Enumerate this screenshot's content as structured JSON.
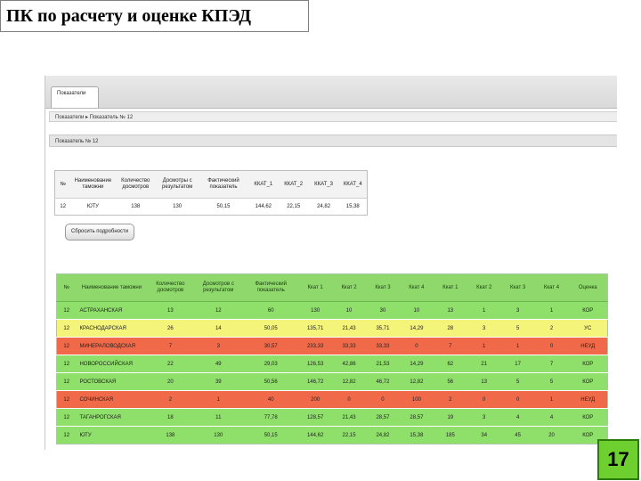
{
  "slide": {
    "title": "ПК по расчету и оценке КПЭД",
    "page_number": "17"
  },
  "app": {
    "tab_label": "Показатели",
    "breadcrumb": "Показатели ▸ Показатель № 12",
    "panel_title": "Показатель № 12",
    "reset_button_label": "Сбросить подробности"
  },
  "summary_table": {
    "headers": [
      "№",
      "Наименование таможни",
      "Количество досмотров",
      "Досмотры с результатом",
      "Фактический показатель",
      "ККАТ_1",
      "ККАТ_2",
      "ККАТ_3",
      "ККАТ_4"
    ],
    "rows": [
      [
        "12",
        "ЮТУ",
        "138",
        "130",
        "50,15",
        "144,62",
        "22,15",
        "24,82",
        "15,38"
      ]
    ]
  },
  "detail_table": {
    "headers": [
      "№",
      "Наименование таможни",
      "Количество досмотров",
      "Досмотров с результатом",
      "Фактический показатель",
      "Ккат 1",
      "Ккат 2",
      "Ккат 3",
      "Ккат 4",
      "Ккат 1",
      "Ккат 2",
      "Ккат 3",
      "Ккат 4",
      "Оценка"
    ],
    "row_colors": {
      "green": "#8ee06a",
      "yellow": "#f4f37a",
      "red": "#f06a4a"
    },
    "rows": [
      {
        "color": "green",
        "cells": [
          "12",
          "АСТРАХАНСКАЯ",
          "13",
          "12",
          "60",
          "130",
          "10",
          "30",
          "10",
          "13",
          "1",
          "3",
          "1",
          "КОР"
        ]
      },
      {
        "color": "yellow",
        "cells": [
          "12",
          "КРАСНОДАРСКАЯ",
          "26",
          "14",
          "50,05",
          "135,71",
          "21,43",
          "35,71",
          "14,29",
          "28",
          "3",
          "5",
          "2",
          "УС"
        ]
      },
      {
        "color": "red",
        "cells": [
          "12",
          "МИНЕРАЛОВОДСКАЯ",
          "7",
          "3",
          "30,57",
          "233,33",
          "33,33",
          "33,33",
          "0",
          "7",
          "1",
          "1",
          "0",
          "НЕУД"
        ]
      },
      {
        "color": "green",
        "cells": [
          "12",
          "НОВОРОССИЙСКАЯ",
          "22",
          "49",
          "29,03",
          "126,53",
          "42,86",
          "21,53",
          "14,29",
          "62",
          "21",
          "17",
          "7",
          "КОР"
        ]
      },
      {
        "color": "green",
        "cells": [
          "12",
          "РОСТОВСКАЯ",
          "20",
          "39",
          "50,56",
          "146,72",
          "12,82",
          "46,72",
          "12,82",
          "56",
          "13",
          "5",
          "5",
          "КОР"
        ]
      },
      {
        "color": "red",
        "cells": [
          "12",
          "СОЧИНСКАЯ",
          "2",
          "1",
          "40",
          "200",
          "0",
          "0",
          "100",
          "2",
          "0",
          "0",
          "1",
          "НЕУД"
        ]
      },
      {
        "color": "green",
        "cells": [
          "12",
          "ТАГАНРОГСКАЯ",
          "18",
          "11",
          "77,78",
          "128,57",
          "21,43",
          "28,57",
          "28,57",
          "19",
          "3",
          "4",
          "4",
          "КОР"
        ]
      },
      {
        "color": "green",
        "cells": [
          "12",
          "ЮТУ",
          "138",
          "130",
          "50,15",
          "144,62",
          "22,15",
          "24,82",
          "15,38",
          "185",
          "34",
          "45",
          "20",
          "КОР"
        ]
      }
    ]
  }
}
